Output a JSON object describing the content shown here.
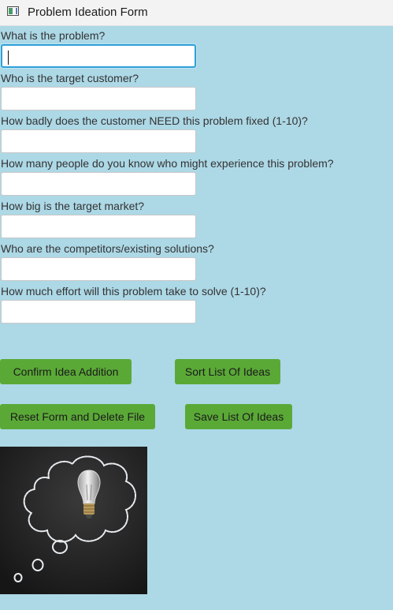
{
  "window": {
    "title": "Problem Ideation Form",
    "icon": "app-window-icon"
  },
  "form": {
    "fields": [
      {
        "label": "What is the problem?",
        "value": "",
        "placeholder": ""
      },
      {
        "label": "Who is the target customer?",
        "value": "",
        "placeholder": ""
      },
      {
        "label": "How badly does the customer NEED this problem fixed (1-10)?",
        "value": "",
        "placeholder": ""
      },
      {
        "label": "How many people do you know who might experience this problem?",
        "value": "",
        "placeholder": ""
      },
      {
        "label": "How big is the target market?",
        "value": "",
        "placeholder": ""
      },
      {
        "label": "Who are the competitors/existing solutions?",
        "value": "",
        "placeholder": ""
      },
      {
        "label": "How much effort will this problem take to solve (1-10)?",
        "value": "",
        "placeholder": ""
      }
    ]
  },
  "buttons": {
    "confirm": "Confirm Idea Addition",
    "sort": "Sort List Of Ideas",
    "reset": "Reset Form and Delete File",
    "save": "Save List Of Ideas"
  },
  "colors": {
    "background": "#add8e6",
    "button": "#5aa937",
    "focus_border": "#2f9fd6"
  },
  "image": {
    "subject": "chalkboard-thought-cloud-lightbulb"
  }
}
